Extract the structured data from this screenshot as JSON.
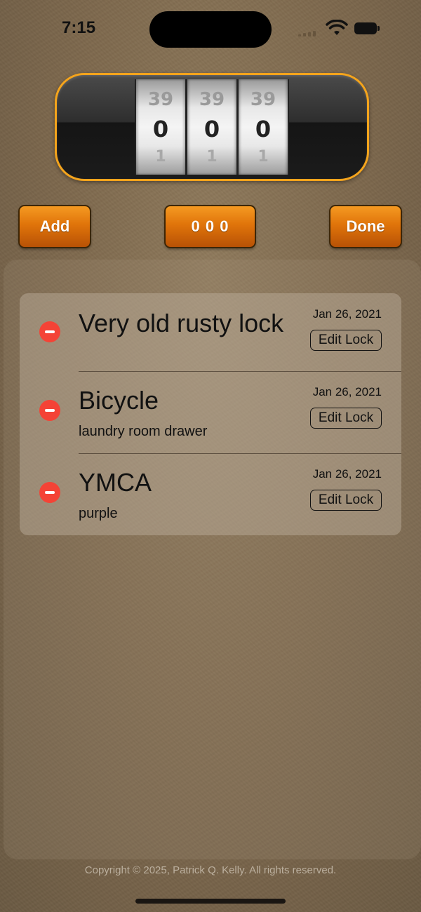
{
  "status_bar": {
    "time": "7:15"
  },
  "lock": {
    "wheels": [
      {
        "top": "39",
        "current": "0",
        "bottom": "1"
      },
      {
        "top": "39",
        "current": "0",
        "bottom": "1"
      },
      {
        "top": "39",
        "current": "0",
        "bottom": "1"
      }
    ]
  },
  "toolbar": {
    "add_label": "Add",
    "combination_label": "0 0 0",
    "done_label": "Done"
  },
  "locks": [
    {
      "name": "Very old rusty lock",
      "note": "",
      "date": "Jan 26, 2021",
      "edit_label": "Edit Lock"
    },
    {
      "name": "Bicycle",
      "note": "laundry room drawer",
      "date": "Jan 26, 2021",
      "edit_label": "Edit Lock"
    },
    {
      "name": "YMCA",
      "note": "purple",
      "date": "Jan 26, 2021",
      "edit_label": "Edit Lock"
    }
  ],
  "footer": {
    "copyright": "Copyright © 2025, Patrick Q. Kelly. All rights reserved."
  },
  "colors": {
    "accent": "#e0740a",
    "lock_border": "#f4a41c",
    "delete": "#f44336"
  },
  "icons": [
    "wifi-icon",
    "battery-icon",
    "signal-icon",
    "delete-icon"
  ]
}
